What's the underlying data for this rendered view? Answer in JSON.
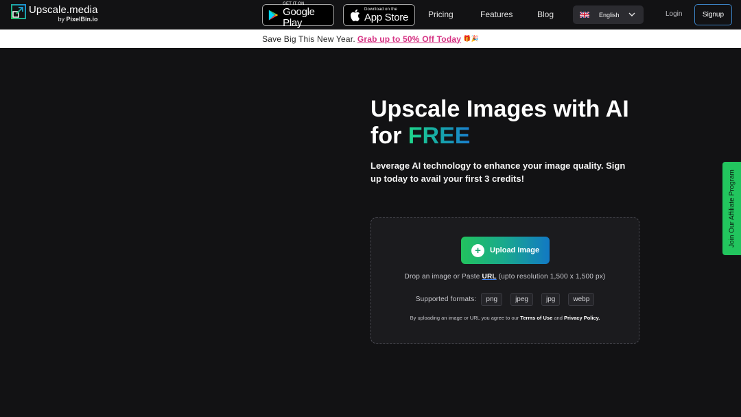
{
  "header": {
    "logo_name": "Upscale.media",
    "logo_by": "by",
    "logo_by_brand": "PixelBin.io",
    "google_play": {
      "small": "GET IT ON",
      "big": "Google Play"
    },
    "app_store": {
      "small": "Download on the",
      "big": "App Store"
    },
    "nav": {
      "pricing": "Pricing",
      "features": "Features",
      "blog": "Blog"
    },
    "language": "English",
    "login": "Login",
    "signup": "Signup"
  },
  "promo": {
    "text": "Save Big This New Year.",
    "deal": "Grab up to 50% Off Today",
    "emoji": "🎁🎉"
  },
  "hero": {
    "title_line1": "Upscale Images with AI",
    "title_for": "for ",
    "title_free": "FREE",
    "subtitle": "Leverage AI technology to enhance your image quality. Sign up today to avail your first 3 credits!"
  },
  "upload": {
    "button_label": "Upload Image",
    "drop_prefix": "Drop an image or Paste ",
    "drop_url": "URL",
    "drop_suffix": " (upto resolution 1,500 x 1,500 px)",
    "formats_label": "Supported formats:",
    "formats": [
      "png",
      "jpeg",
      "jpg",
      "webp"
    ],
    "terms_prefix": "By uploading an image or URL you agree to our ",
    "terms_link": "Terms of Use",
    "terms_and": " and ",
    "privacy_link": "Privacy Policy."
  },
  "affiliate": "Join Our Affiliate Program",
  "colors": {
    "background": "#121214",
    "accent_green": "#22c55e",
    "accent_blue": "#1279c4",
    "promo_pink": "#d63384"
  }
}
